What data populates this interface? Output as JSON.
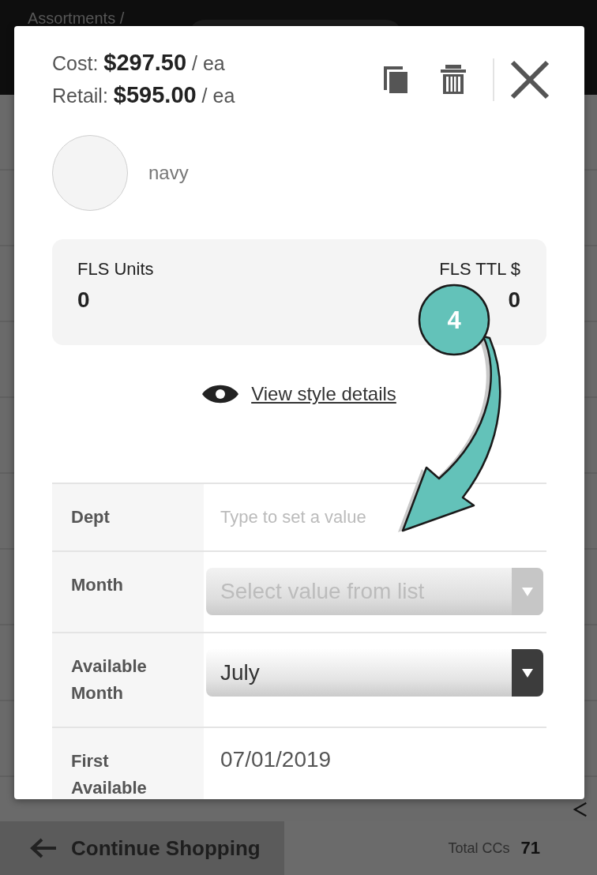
{
  "header": {
    "breadcrumb": "Assortments /"
  },
  "modal": {
    "cost": "Cost: **$297.50** / ea",
    "retail": "Retail: **$595.00** / ea",
    "color_name": "navy",
    "summary": [
      {
        "label": "FLS Units",
        "value": "0"
      },
      {
        "label": "FLS TTL $",
        "value": "0"
      }
    ],
    "link": "View style details",
    "fields": [
      {
        "label": "Dept",
        "kind": "text",
        "placeholder": "Type to set a value"
      },
      {
        "label": "Month",
        "kind": "select",
        "placeholder": "Select value from list"
      },
      {
        "label": "Available Month",
        "kind": "select",
        "value": "July"
      },
      {
        "label": "First Available",
        "kind": "date",
        "value": "07/01/2019"
      }
    ]
  },
  "annotation": {
    "step": "4"
  },
  "bottom_bar": {
    "back_button": "Continue Shopping",
    "total_label": "Total CCs",
    "total_value": "71"
  }
}
